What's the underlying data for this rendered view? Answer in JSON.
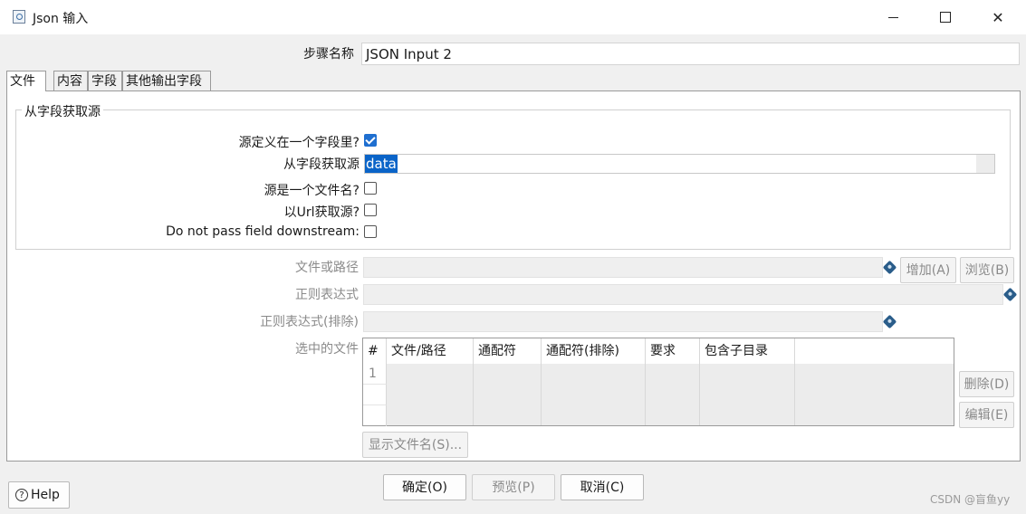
{
  "window": {
    "title": "Json 输入",
    "min_icon": "minimize-icon",
    "max_icon": "maximize-icon",
    "close_symbol": "✕"
  },
  "step": {
    "label": "步骤名称",
    "value": "JSON Input 2"
  },
  "tabs": [
    {
      "label": "文件",
      "active": true
    },
    {
      "label": "内容"
    },
    {
      "label": "字段"
    },
    {
      "label": "其他输出字段"
    }
  ],
  "group": {
    "title": "从字段获取源",
    "source_in_field_label": "源定义在一个字段里?",
    "source_in_field_checked": true,
    "source_field_label": "从字段获取源",
    "source_field_value": "data",
    "source_is_filename_label": "源是一个文件名?",
    "source_is_filename_checked": false,
    "read_url_label": "以Url获取源?",
    "read_url_checked": false,
    "do_not_pass_label": "Do not pass field downstream:",
    "do_not_pass_checked": false
  },
  "file": {
    "path_label": "文件或路径",
    "add_button": "增加(A)",
    "browse_button": "浏览(B)",
    "regex_label": "正则表达式",
    "regex_exclude_label": "正则表达式(排除)",
    "selected_files_label": "选中的文件",
    "delete_button": "删除(D)",
    "edit_button": "编辑(E)",
    "show_filenames_button": "显示文件名(S)..."
  },
  "table": {
    "headers": [
      "#",
      "文件/路径",
      "通配符",
      "通配符(排除)",
      "要求",
      "包含子目录"
    ],
    "rows": [
      {
        "num": "1"
      }
    ]
  },
  "footer": {
    "help_label": "Help",
    "ok_button": "确定(O)",
    "preview_button": "预览(P)",
    "cancel_button": "取消(C)",
    "watermark": "CSDN @盲鱼yy"
  }
}
